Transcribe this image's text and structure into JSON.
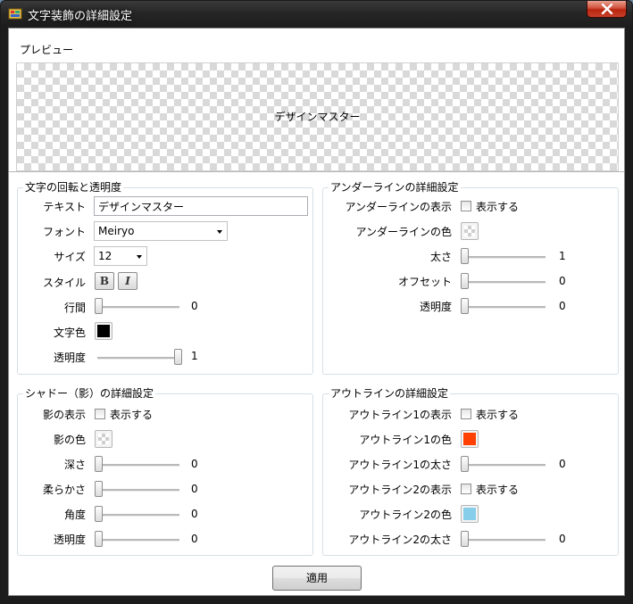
{
  "window": {
    "title": "文字装飾の詳細設定"
  },
  "preview": {
    "label": "プレビュー",
    "text": "デザインマスター"
  },
  "text_group": {
    "title": "文字の回転と透明度",
    "text_label": "テキスト",
    "text_value": "デザインマスター",
    "font_label": "フォント",
    "font_value": "Meiryo",
    "size_label": "サイズ",
    "size_value": "12",
    "style_label": "スタイル",
    "bold": "B",
    "italic": "I",
    "line_spacing_label": "行間",
    "line_spacing_value": "0",
    "line_spacing_fraction": 0,
    "color_label": "文字色",
    "color": "#000000",
    "opacity_label": "透明度",
    "opacity_value": "1",
    "opacity_fraction": 1
  },
  "underline_group": {
    "title": "アンダーラインの詳細設定",
    "show_label": "アンダーラインの表示",
    "show_check": "表示する",
    "show_checked": false,
    "color_label": "アンダーラインの色",
    "thickness_label": "太さ",
    "thickness_value": "1",
    "offset_label": "オフセット",
    "offset_value": "0",
    "opacity_label": "透明度",
    "opacity_value": "0"
  },
  "shadow_group": {
    "title": "シャドー（影）の詳細設定",
    "show_label": "影の表示",
    "show_check": "表示する",
    "show_checked": false,
    "color_label": "影の色",
    "depth_label": "深さ",
    "depth_value": "0",
    "softness_label": "柔らかさ",
    "softness_value": "0",
    "angle_label": "角度",
    "angle_value": "0",
    "opacity_label": "透明度",
    "opacity_value": "0"
  },
  "outline_group": {
    "title": "アウトラインの詳細設定",
    "outline1_show_label": "アウトライン1の表示",
    "outline1_show_check": "表示する",
    "outline1_checked": false,
    "outline1_color_label": "アウトライン1の色",
    "outline1_color": "#ff4000",
    "outline1_width_label": "アウトライン1の太さ",
    "outline1_width_value": "0",
    "outline2_show_label": "アウトライン2の表示",
    "outline2_show_check": "表示する",
    "outline2_checked": false,
    "outline2_color_label": "アウトライン2の色",
    "outline2_color": "#87ceeb",
    "outline2_width_label": "アウトライン2の太さ",
    "outline2_width_value": "0"
  },
  "apply_label": "適用"
}
